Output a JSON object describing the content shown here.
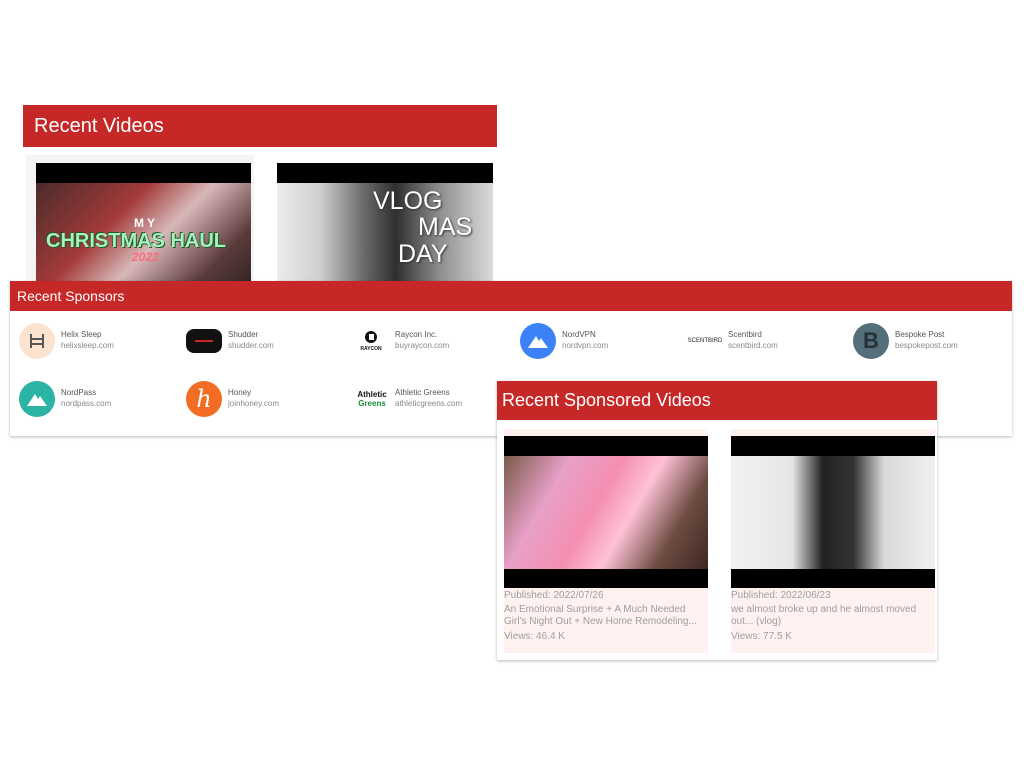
{
  "recent_videos": {
    "header": "Recent Videos",
    "videos": [
      {
        "thumb_lines": [
          "MY",
          "CHRISTMAS HAUL",
          "2022"
        ]
      },
      {
        "thumb_lines": [
          "VLOG",
          "MAS",
          "DAY"
        ]
      }
    ]
  },
  "recent_sponsors": {
    "header": "Recent Sponsors",
    "items": [
      {
        "name": "Helix Sleep",
        "domain": "helixsleep.com",
        "icon": "bed-icon",
        "color": "#fbe3cf"
      },
      {
        "name": "Shudder",
        "domain": "shudder.com",
        "icon": "shudder-logo",
        "color": "#111111"
      },
      {
        "name": "Raycon Inc.",
        "domain": "buyraycon.com",
        "icon": "raycon-logo",
        "logo_text": "RAYCON",
        "color": "#111111"
      },
      {
        "name": "NordVPN",
        "domain": "nordvpn.com",
        "icon": "mountain-icon",
        "color": "#3b82f6"
      },
      {
        "name": "Scentbird",
        "domain": "scentbird.com",
        "icon": "scentbird-logo",
        "logo_text": "SCENTBIRD",
        "color": "#222222"
      },
      {
        "name": "Bespoke Post",
        "domain": "bespokepost.com",
        "icon": "letter-b-icon",
        "logo_text": "B",
        "color": "#546e7a"
      },
      {
        "name": "NordPass",
        "domain": "nordpass.com",
        "icon": "mountain-icon",
        "color": "#2bb3a3"
      },
      {
        "name": "Honey",
        "domain": "joinhoney.com",
        "icon": "letter-h-icon",
        "logo_text": "h",
        "color": "#f26c23"
      },
      {
        "name": "Athletic Greens",
        "domain": "athleticgreens.com",
        "icon": "athletic-greens-logo",
        "logo_text": "Athletic",
        "logo_text2": "Greens",
        "color": "#1b8a3a"
      }
    ]
  },
  "recent_sponsored_videos": {
    "header": "Recent Sponsored Videos",
    "videos": [
      {
        "published": "Published: 2022/07/26",
        "title": "An Emotional Surprise + A Much Needed Girl's Night Out + New Home Remodeling...",
        "views": "Views: 46.4 K"
      },
      {
        "published": "Published: 2022/06/23",
        "title": "we almost broke up and he almost moved out... (vlog)",
        "views": "Views: 77.5 K"
      }
    ]
  },
  "colors": {
    "header_red": "#c62828",
    "card_pink": "#fff1f0",
    "meta_gray": "#9e9e9e"
  }
}
